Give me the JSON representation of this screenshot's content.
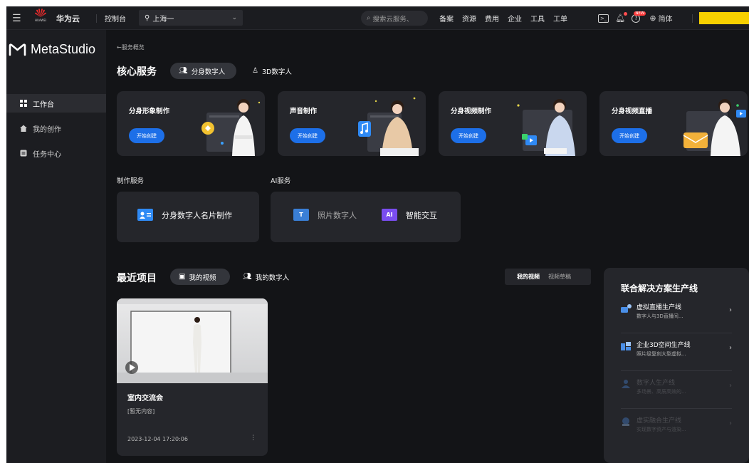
{
  "topbar": {
    "brand": "华为云",
    "logo_text": "HUAWEI",
    "console": "控制台",
    "region": "上海一",
    "search_placeholder": "搜索云服务、",
    "nav": [
      "备案",
      "资源",
      "费用",
      "企业",
      "工具",
      "工单"
    ],
    "new_badge": "NEW",
    "language": "简体"
  },
  "sidebar": {
    "brand": "MetaStudio",
    "items": [
      {
        "label": "工作台",
        "icon": "grid-icon",
        "active": true
      },
      {
        "label": "我的创作",
        "icon": "home-icon",
        "active": false
      },
      {
        "label": "任务中心",
        "icon": "task-icon",
        "active": false
      }
    ]
  },
  "breadcrumb": "←服务概览",
  "core": {
    "title": "核心服务",
    "tabs": [
      {
        "label": "分身数字人",
        "active": true
      },
      {
        "label": "3D数字人",
        "active": false
      }
    ],
    "cards": [
      {
        "title": "分身形象制作",
        "button": "开始创建"
      },
      {
        "title": "声音制作",
        "button": "开始创建"
      },
      {
        "title": "分身视频制作",
        "button": "开始创建"
      },
      {
        "title": "分身视频直播",
        "button": "开始创建"
      }
    ]
  },
  "production": {
    "label": "制作服务",
    "items": [
      {
        "label": "分身数字人名片制作"
      }
    ]
  },
  "ai": {
    "label": "AI服务",
    "items": [
      {
        "label": "照片数字人",
        "icon_text": "T"
      },
      {
        "label": "智能交互",
        "icon_text": "AI"
      }
    ]
  },
  "recent": {
    "title": "最近项目",
    "tabs": [
      {
        "label": "我的视频",
        "active": true
      },
      {
        "label": "我的数字人",
        "active": false
      }
    ],
    "filter": {
      "active": "我的视频",
      "inactive": "视频草稿"
    },
    "video": {
      "title": "室内交流会",
      "subtitle": "[暂无内容]",
      "date": "2023-12-04 17:20:06"
    }
  },
  "solutions": {
    "title": "联合解决方案生产线",
    "lines": [
      {
        "name": "虚拟直播生产线",
        "desc": "数字人与3D直播间...",
        "enabled": true
      },
      {
        "name": "企业3D空间生产线",
        "desc": "照片级复刻大型虚拟...",
        "enabled": true
      },
      {
        "name": "数字人生产线",
        "desc": "多场景、高质高效的...",
        "enabled": false
      },
      {
        "name": "虚实融合生产线",
        "desc": "实现数字资产与渲染...",
        "enabled": false
      }
    ]
  },
  "colors": {
    "accent": "#1d6fe8",
    "highlight": "#f7d000",
    "background": "#131417",
    "card": "#25262b"
  }
}
